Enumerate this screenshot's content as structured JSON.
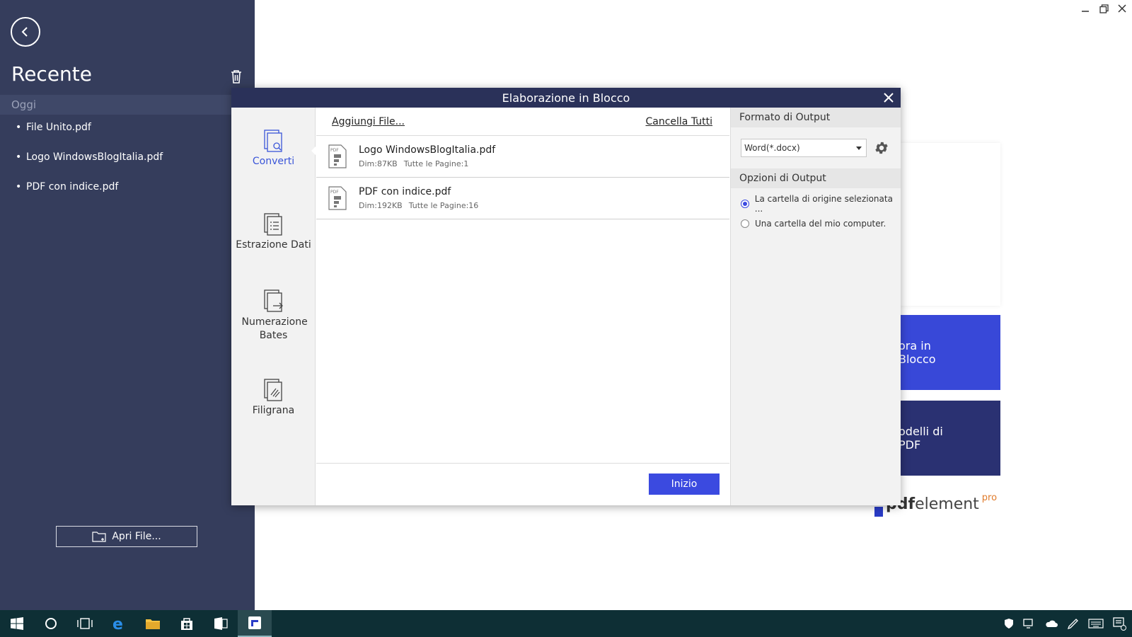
{
  "sidebar": {
    "title": "Recente",
    "section": "Oggi",
    "recent_files": [
      "File Unito.pdf",
      "Logo WindowsBlogItalia.pdf",
      "PDF con indice.pdf"
    ],
    "open_file_label": "Apri File..."
  },
  "background": {
    "batch_card_label": "ora in Blocco",
    "templates_card_label": "odelli di PDF",
    "brand_bold": "pdf",
    "brand_rest": "element",
    "brand_suffix": "pro"
  },
  "dialog": {
    "title": "Elaborazione in Blocco",
    "tools": [
      {
        "label": "Converti",
        "active": true
      },
      {
        "label": "Estrazione Dati",
        "active": false
      },
      {
        "label": "Numerazione Bates",
        "active": false
      },
      {
        "label": "Filigrana",
        "active": false
      }
    ],
    "add_files_label": "Aggiungi File...",
    "clear_all_label": "Cancella Tutti",
    "files": [
      {
        "name": "Logo WindowsBlogItalia.pdf",
        "size": "Dim:87KB",
        "pages": "Tutte le Pagine:1"
      },
      {
        "name": "PDF con indice.pdf",
        "size": "Dim:192KB",
        "pages": "Tutte le Pagine:16"
      }
    ],
    "start_label": "Inizio",
    "output_format_header": "Formato di Output",
    "output_format_value": "Word(*.docx)",
    "output_options_header": "Opzioni di Output",
    "output_options": [
      {
        "label": "La cartella di origine selezionata ...",
        "selected": true
      },
      {
        "label": "Una cartella del mio computer.",
        "selected": false
      }
    ]
  },
  "colors": {
    "sidebar_bg": "#353d5c",
    "dialog_header_bg": "#2a3159",
    "accent_blue": "#3b4ae0",
    "taskbar_bg": "#0e2f35"
  },
  "taskbar": {
    "items": [
      "windows-start-icon",
      "cortana-icon",
      "task-view-icon",
      "edge-icon",
      "file-explorer-icon",
      "store-icon",
      "word-icon",
      "pdfelement-icon"
    ],
    "tray": [
      "defender-icon",
      "display-icon",
      "onedrive-icon",
      "pen-icon",
      "keyboard-icon",
      "notification-icon"
    ]
  }
}
